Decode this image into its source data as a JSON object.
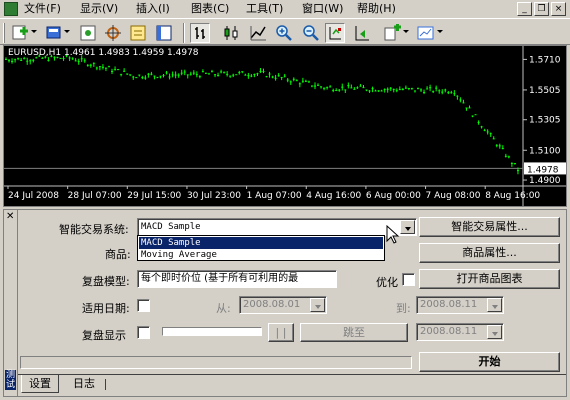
{
  "menubar": {
    "items": [
      "文件(F)",
      "显示(V)",
      "插入(I)",
      "图表(C)",
      "工具(T)",
      "窗口(W)",
      "帮助(H)"
    ]
  },
  "window_buttons": [
    "_",
    "❐",
    "×"
  ],
  "toolbar": {
    "icons": [
      "new-chart-icon",
      "profiles-icon",
      "navigator-icon",
      "crosshair-icon",
      "data-window-icon",
      "terminal-icon",
      "bar-chart-icon",
      "candlestick-icon",
      "line-chart-icon",
      "zoom-in-icon",
      "zoom-out-icon",
      "chart-shift-icon",
      "auto-scroll-icon",
      "indicators-icon",
      "templates-icon"
    ]
  },
  "chart": {
    "title": "EURUSD,H1  1.4961 1.4983 1.4959 1.4978",
    "price_labels": [
      "1.5710",
      "1.5505",
      "1.5305",
      "1.5100",
      "1.4978",
      "1.4900"
    ],
    "current_price": "1.4978",
    "time_labels": [
      "24 Jul 2008",
      "28 Jul 07:00",
      "29 Jul 15:00",
      "30 Jul 23:00",
      "1 Aug 07:00",
      "4 Aug 16:00",
      "6 Aug 00:00",
      "7 Aug 08:00",
      "8 Aug 16:00"
    ],
    "colors": {
      "background": "#000000",
      "candles": "#00ff00",
      "grid": "#c0c0c0",
      "current_line": "#808080"
    }
  },
  "chart_data": {
    "type": "line",
    "title": "EURUSD,H1",
    "x": [
      "24 Jul 2008",
      "28 Jul 07:00",
      "29 Jul 15:00",
      "30 Jul 23:00",
      "1 Aug 07:00",
      "4 Aug 16:00",
      "6 Aug 00:00",
      "7 Aug 08:00",
      "8 Aug 16:00"
    ],
    "series": [
      {
        "name": "EURUSD,H1",
        "values": [
          1.571,
          1.572,
          1.56,
          1.561,
          1.5615,
          1.552,
          1.551,
          1.55,
          1.497
        ]
      }
    ],
    "ylabel": "",
    "ylim": [
      1.486,
      1.58
    ],
    "yticks": [
      1.571,
      1.5505,
      1.5305,
      1.51,
      1.49
    ],
    "ohlc_last": {
      "open": 1.4961,
      "high": 1.4983,
      "low": 1.4959,
      "close": 1.4978
    },
    "grid": true
  },
  "tester": {
    "ea_label": "智能交易系统:",
    "ea_value": "MACD Sample",
    "ea_options": [
      "MACD Sample",
      "Moving Average"
    ],
    "ea_props_button": "智能交易属性...",
    "symbol_label": "商品:",
    "symbol_props_button": "商品属性...",
    "model_label": "复盘模型:",
    "model_value": "每个即时价位 (基于所有可利用的最",
    "optimize_label": "优化",
    "open_chart_button": "打开商品图表",
    "use_date_label": "适用日期:",
    "from_label": "从:",
    "from_value": "2008.08.01",
    "to_label": "到:",
    "to_value": "2008.08.11",
    "visual_label": "复盘显示",
    "pause_button": "| |",
    "skip_button": "跳至",
    "skip_date": "2008.08.11",
    "start_button": "开始",
    "side_label": "测试"
  },
  "tabs": [
    "设置",
    "日志"
  ]
}
